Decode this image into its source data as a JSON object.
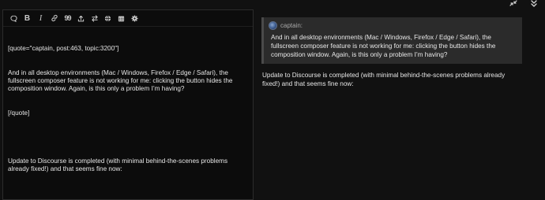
{
  "window_controls": {
    "collapse_icon": "collapse-icon",
    "minimize_icon": "chevron-double-down-icon"
  },
  "toolbar": {
    "buttons": [
      {
        "name": "quote-button",
        "icon": "speech-bubble-icon"
      },
      {
        "name": "bold-button",
        "label": "B"
      },
      {
        "name": "italic-button",
        "label": "I"
      },
      {
        "name": "link-button",
        "icon": "link-icon"
      },
      {
        "name": "blockquote-button",
        "label": "99"
      },
      {
        "name": "upload-button",
        "icon": "upload-icon"
      },
      {
        "name": "toggle-direction-button",
        "icon": "swap-icon"
      },
      {
        "name": "emoji-button",
        "icon": "globe-icon"
      },
      {
        "name": "date-button",
        "icon": "calendar-icon"
      },
      {
        "name": "options-button",
        "icon": "gear-icon"
      }
    ]
  },
  "editor": {
    "quote_open": "[quote=\"captain, post:463, topic:3200\"]",
    "quote_text": "And in all desktop environments (Mac / Windows, Firefox / Edge / Safari), the fullscreen composer feature is not working for me: clicking the button hides the composition window. Again, is this only a problem I’m having?",
    "quote_close": "[/quote]",
    "reply_text": "Update to Discourse is completed (with minimal behind-the-scenes problems already fixed!) and that seems fine now:"
  },
  "preview": {
    "quote_author": "captain:",
    "quote_text": "And in all desktop environments (Mac / Windows, Firefox / Edge / Safari), the fullscreen composer feature is not working for me: clicking the button hides the composition window. Again, is this only a problem I’m having?",
    "reply_text": "Update to Discourse is completed (with minimal behind-the-scenes problems already fixed!) and that seems fine now:"
  }
}
